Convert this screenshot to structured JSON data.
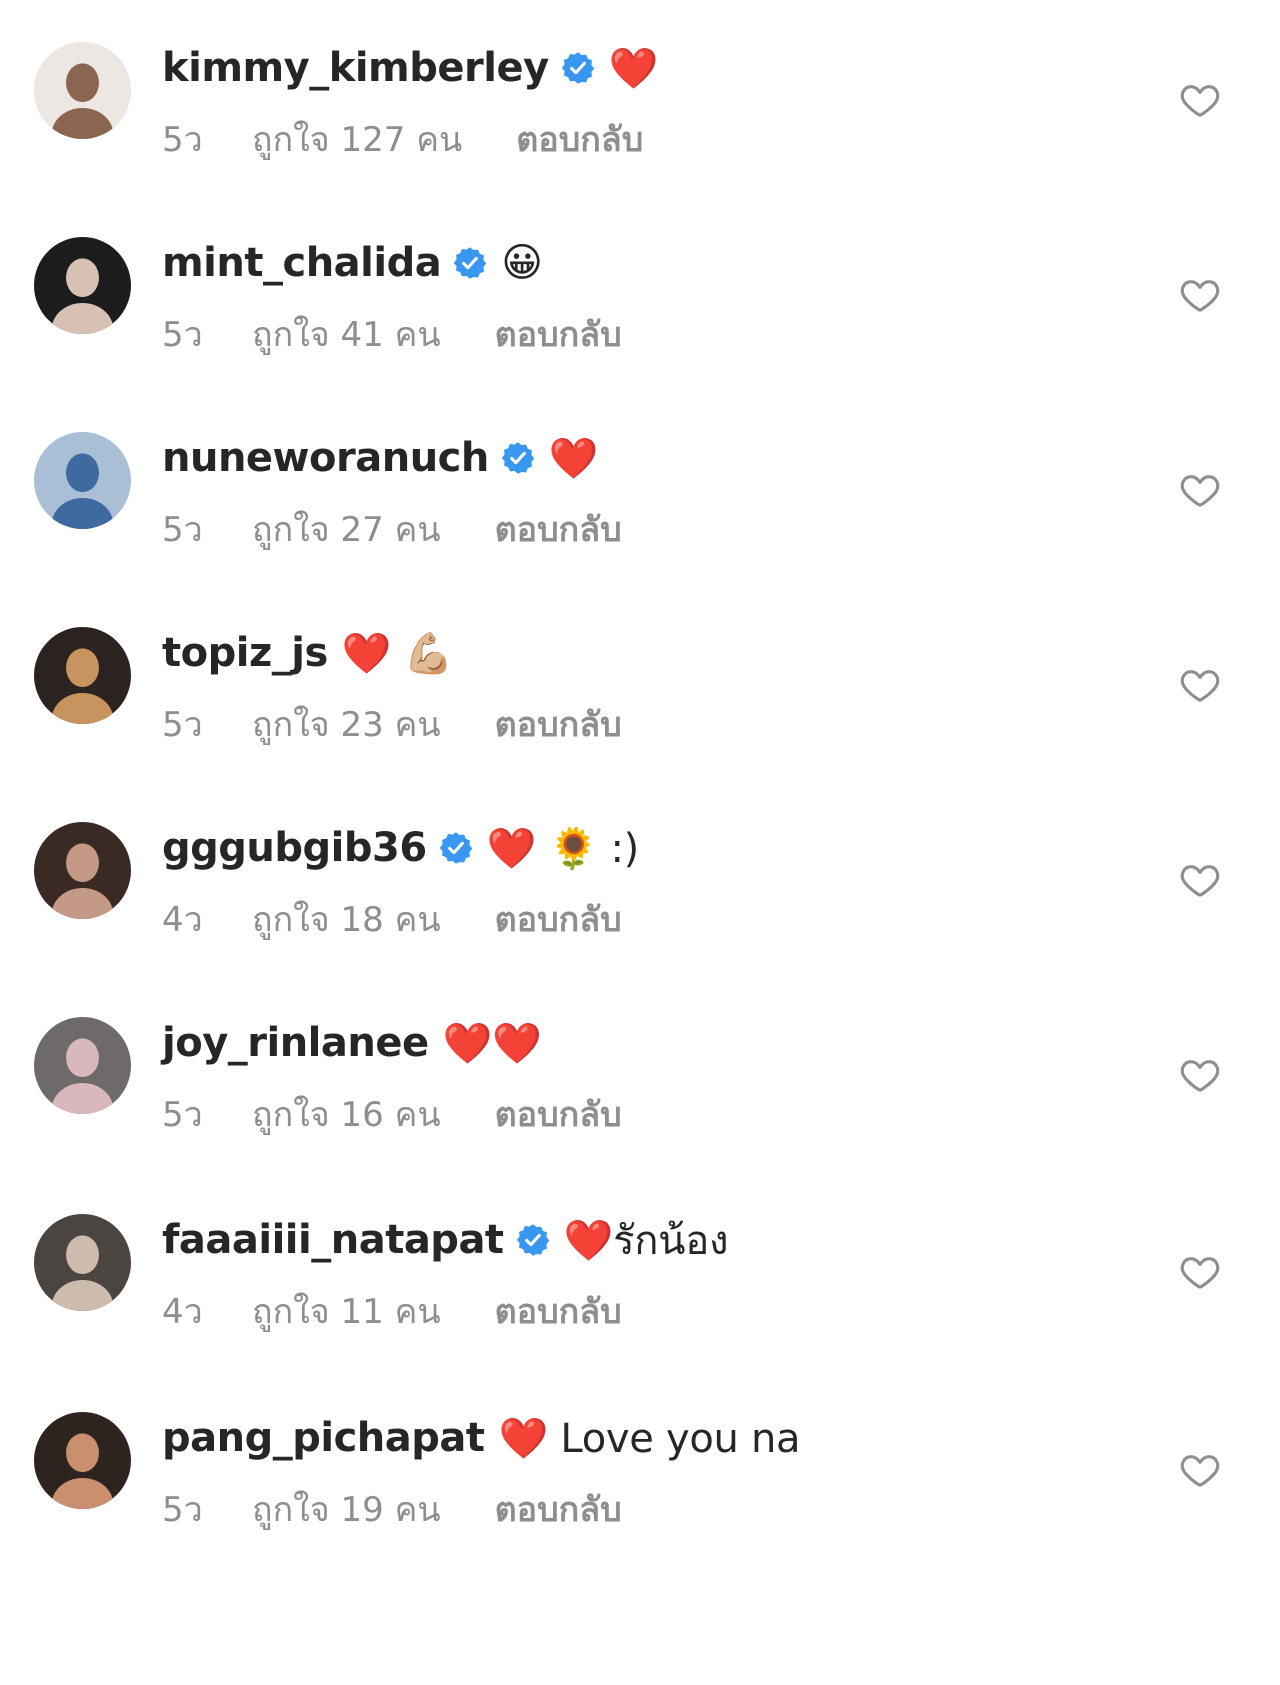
{
  "colors": {
    "username": "#262626",
    "meta": "#8e8e8e",
    "verified_badge": "#3897f0",
    "like_outline": "#8e8e8e",
    "background": "#ffffff"
  },
  "icons": {
    "verified": "verified-badge-icon",
    "like": "heart-outline-icon"
  },
  "comments": [
    {
      "username": "kimmy_kimberley",
      "verified": true,
      "text": "❤️",
      "time": "5ว",
      "likes": "ถูกใจ 127 คน",
      "reply": "ตอบกลับ",
      "avatar_colors": [
        "#ece7e2",
        "#8a6650"
      ]
    },
    {
      "username": "mint_chalida",
      "verified": true,
      "text": "😀",
      "time": "5ว",
      "likes": "ถูกใจ 41 คน",
      "reply": "ตอบกลับ",
      "avatar_colors": [
        "#1c1c1c",
        "#d6c1b3"
      ]
    },
    {
      "username": "nuneworanuch",
      "verified": true,
      "text": "❤️",
      "time": "5ว",
      "likes": "ถูกใจ 27 คน",
      "reply": "ตอบกลับ",
      "avatar_colors": [
        "#a8bfd6",
        "#3f6aa0"
      ]
    },
    {
      "username": "topiz_js",
      "verified": false,
      "text": "❤️ 💪🏼",
      "time": "5ว",
      "likes": "ถูกใจ 23 คน",
      "reply": "ตอบกลับ",
      "avatar_colors": [
        "#2a2320",
        "#c7935e"
      ]
    },
    {
      "username": "gggubgib36",
      "verified": true,
      "text": "❤️ 🌻 :)",
      "time": "4ว",
      "likes": "ถูกใจ 18 คน",
      "reply": "ตอบกลับ",
      "avatar_colors": [
        "#3a2a24",
        "#c49a86"
      ]
    },
    {
      "username": "joy_rinlanee",
      "verified": false,
      "text": "❤️❤️",
      "time": "5ว",
      "likes": "ถูกใจ 16 คน",
      "reply": "ตอบกลับ",
      "avatar_colors": [
        "#6f6a6a",
        "#d8b7bd"
      ]
    },
    {
      "username": "faaaiiii_natapat",
      "verified": true,
      "text": "❤️รักน้อง",
      "time": "4ว",
      "likes": "ถูกใจ 11 คน",
      "reply": "ตอบกลับ",
      "avatar_colors": [
        "#4b4542",
        "#cdbcab"
      ]
    },
    {
      "username": "pang_pichapat",
      "verified": false,
      "text": "❤️ Love you na",
      "time": "5ว",
      "likes": "ถูกใจ 19 คน",
      "reply": "ตอบกลับ",
      "avatar_colors": [
        "#2d2420",
        "#c98f6f"
      ]
    }
  ]
}
